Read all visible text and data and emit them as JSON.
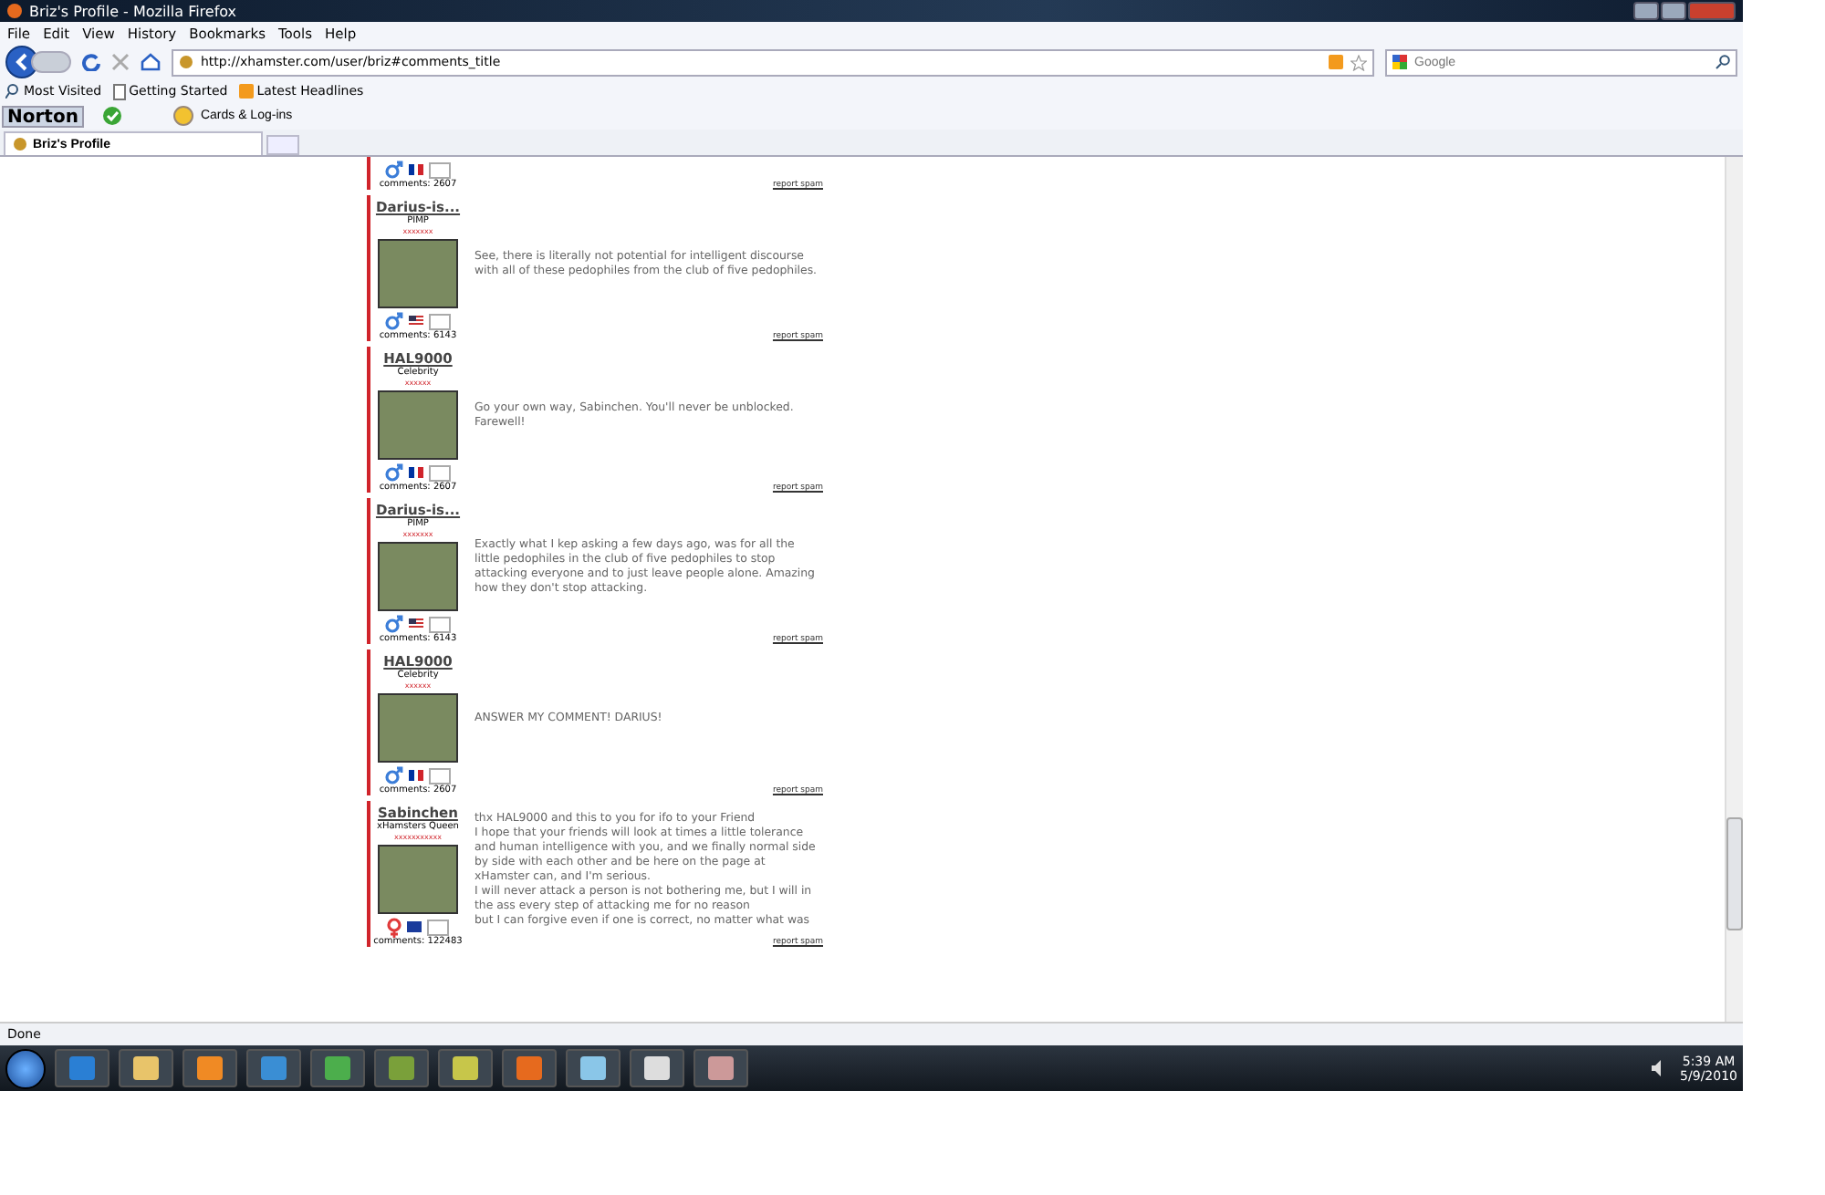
{
  "window": {
    "title": "Briz's Profile - Mozilla Firefox"
  },
  "menu": [
    "File",
    "Edit",
    "View",
    "History",
    "Bookmarks",
    "Tools",
    "Help"
  ],
  "address": {
    "value": "http://xhamster.com/user/briz#comments_title"
  },
  "search": {
    "placeholder": "Google"
  },
  "bookmarks": [
    {
      "label": "Most Visited",
      "kind": "search"
    },
    {
      "label": "Getting Started",
      "kind": "page"
    },
    {
      "label": "Latest Headlines",
      "kind": "feed"
    }
  ],
  "norton": {
    "brand": "Norton",
    "cards": "Cards & Log-ins"
  },
  "tabs": [
    {
      "label": "Briz's Profile",
      "selected": true
    }
  ],
  "top_partial": {
    "count": "comments: 2607",
    "report": "report spam"
  },
  "comments": [
    {
      "name": "Darius-is...",
      "rank": "PIMP",
      "stars": "xxxxxxx",
      "gender": {
        "kind": "male"
      },
      "flag": {
        "kind": "us"
      },
      "count": "comments: 6143",
      "text": "See, there is literally not potential for intelligent discourse with all of these pedophiles from the club of five pedophiles.",
      "report": "report spam"
    },
    {
      "name": "HAL9000",
      "rank": "Celebrity",
      "stars": "xxxxxx",
      "gender": {
        "kind": "male"
      },
      "flag": {
        "kind": "fr"
      },
      "count": "comments: 2607",
      "text": "Go your own way, Sabinchen. You'll never be unblocked. Farewell!",
      "report": "report spam"
    },
    {
      "name": "Darius-is...",
      "rank": "PIMP",
      "stars": "xxxxxxx",
      "gender": {
        "kind": "male"
      },
      "flag": {
        "kind": "us"
      },
      "count": "comments: 6143",
      "text": "Exactly what I kep asking a few days ago, was for all the little pedophiles in the club of five pedophiles to stop attacking everyone and to just leave people alone. Amazing how they don't stop attacking.",
      "report": "report spam"
    },
    {
      "name": "HAL9000",
      "rank": "Celebrity",
      "stars": "xxxxxx",
      "gender": {
        "kind": "male"
      },
      "flag": {
        "kind": "fr"
      },
      "count": "comments: 2607",
      "text": "ANSWER MY COMMENT! DARIUS!",
      "report": "report spam"
    },
    {
      "name": "Sabinchen",
      "rank": "xHamsters Queen",
      "stars": "xxxxxxxxxxx",
      "gender": {
        "kind": "female"
      },
      "flag": {
        "kind": "eu"
      },
      "count": "comments: 122483",
      "text": "thx HAL9000 and this to you for ifo to your Friend\nI hope that your friends will look at times a little tolerance and human intelligence with you, and we finally normal side by side with each other and be here on the page at xHamster can, and I'm serious.\nI will never attack a person is not bothering me, but I will in the ass every step of attacking me for no reason\nbut I can forgive even if one is correct, no matter what was",
      "report": "report spam"
    }
  ],
  "status_bar": {
    "text": "Done"
  },
  "clock": {
    "time": "5:39 AM",
    "date": "5/9/2010"
  }
}
